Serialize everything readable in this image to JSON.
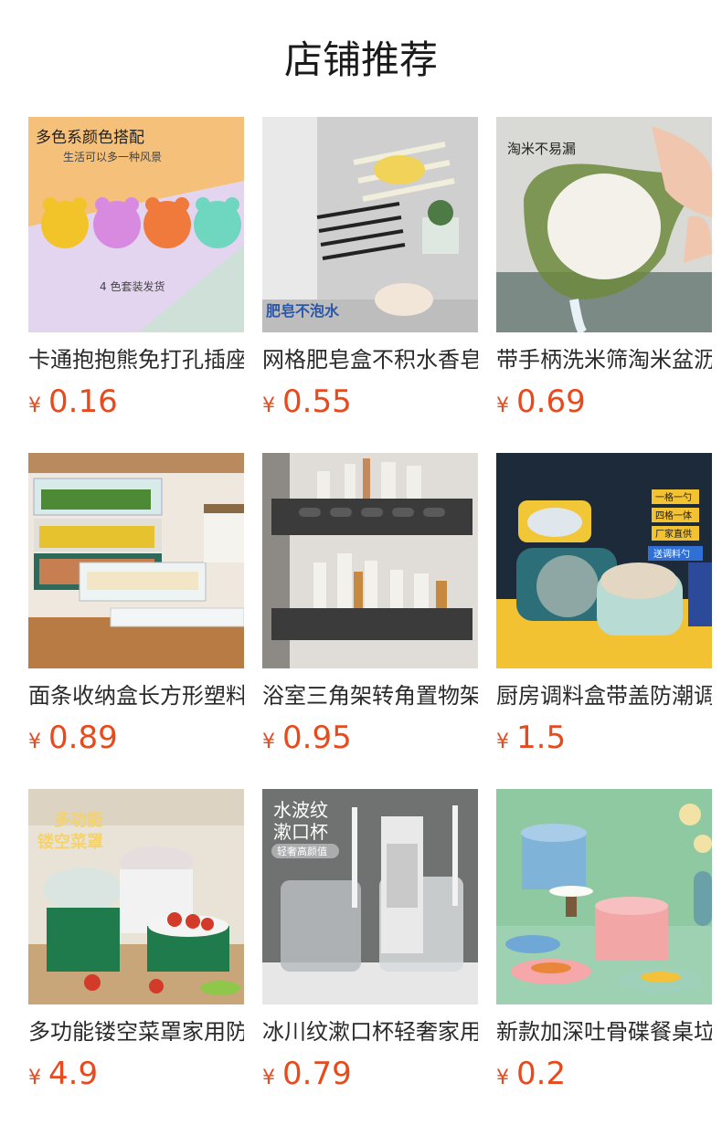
{
  "section_title": "店铺推荐",
  "currency_symbol": "¥",
  "products": [
    {
      "name": "卡通抱抱熊免打孔插座固定器",
      "price": "0.16",
      "image_text": [
        "多色系颜色搭配",
        "生活可以多一种风景",
        "4 色套装发货"
      ]
    },
    {
      "name": "网格肥皂盒不积水香皂架",
      "price": "0.55",
      "image_text": [
        "肥皂不泡水"
      ]
    },
    {
      "name": "带手柄洗米筛淘米盆沥水篮",
      "price": "0.69",
      "image_text": [
        "淘米不易漏"
      ]
    },
    {
      "name": "面条收纳盒长方形塑料保鲜盒",
      "price": "0.89",
      "image_text": []
    },
    {
      "name": "浴室三角架转角置物架免打孔",
      "price": "0.95",
      "image_text": []
    },
    {
      "name": "厨房调料盒带盖防潮调味罐",
      "price": "1.5",
      "image_text": [
        "一格一勺",
        "四格一体",
        "厂家直供",
        "送调料勺"
      ]
    },
    {
      "name": "多功能镂空菜罩家用防苍蝇",
      "price": "4.9",
      "image_text": [
        "多功能",
        "镂空菜罩"
      ]
    },
    {
      "name": "冰川纹漱口杯轻奢家用刷牙杯",
      "price": "0.79",
      "image_text": [
        "水波纹",
        "漱口杯",
        "轻奢高颜值"
      ]
    },
    {
      "name": "新款加深吐骨碟餐桌垃圾盘",
      "price": "0.2",
      "image_text": []
    }
  ]
}
